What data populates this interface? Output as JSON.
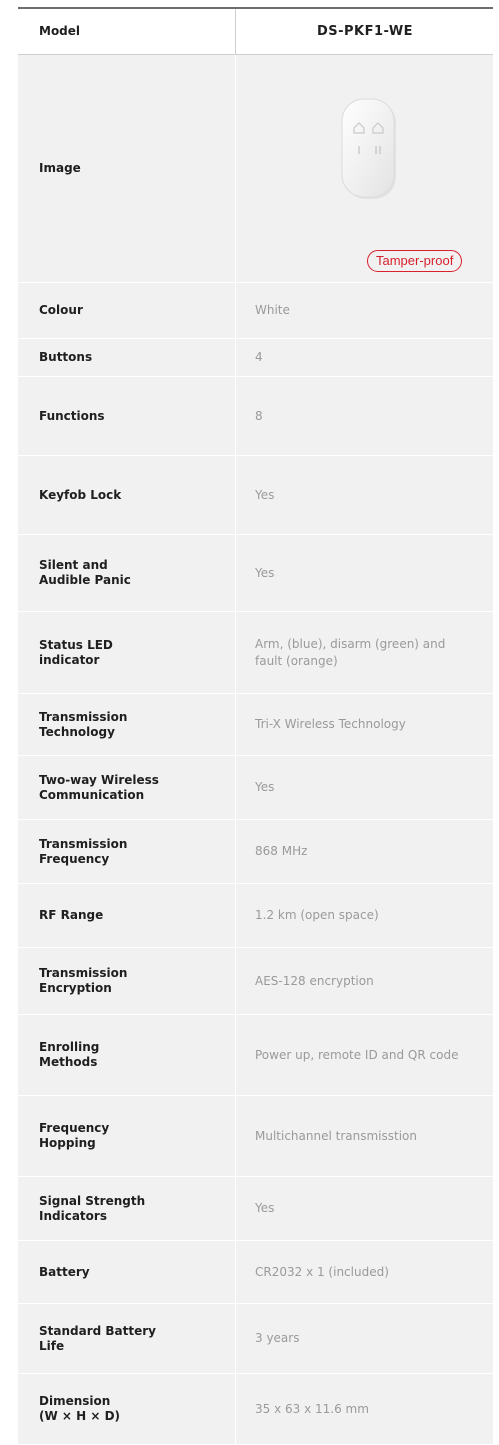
{
  "header": {
    "label": "Model",
    "value": "DS-PKF1-WE"
  },
  "image_row": {
    "label": "Image",
    "badge": "Tamper-proof"
  },
  "rows": [
    {
      "label": "Colour",
      "value": "White"
    },
    {
      "label": "Buttons",
      "value": "4"
    },
    {
      "label": "Functions",
      "value": "8"
    },
    {
      "label": "Keyfob Lock",
      "value": "Yes"
    },
    {
      "label": "Silent and\nAudible Panic",
      "value": "Yes"
    },
    {
      "label": "Status LED\nindicator",
      "value": "Arm, (blue), disarm (green) and fault (orange)"
    },
    {
      "label": "Transmission\nTechnology",
      "value": "Tri-X Wireless Technology"
    },
    {
      "label": "Two-way Wireless\nCommunication",
      "value": "Yes"
    },
    {
      "label": "Transmission\nFrequency",
      "value": "868 MHz"
    },
    {
      "label": "RF Range",
      "value": "1.2 km (open space)"
    },
    {
      "label": "Transmission\nEncryption",
      "value": "AES-128 encryption"
    },
    {
      "label": "Enrolling\nMethods",
      "value": "Power up, remote ID and QR code"
    },
    {
      "label": "Frequency\nHopping",
      "value": "Multichannel transmisstion"
    },
    {
      "label": "Signal Strength\nIndicators",
      "value": "Yes"
    },
    {
      "label": "Battery",
      "value": "CR2032 x 1 (included)"
    },
    {
      "label": "Standard Battery\nLife",
      "value": "3 years"
    },
    {
      "label": "Dimension\n(W × H × D)",
      "value": "35 x 63 x 11.6 mm"
    }
  ]
}
